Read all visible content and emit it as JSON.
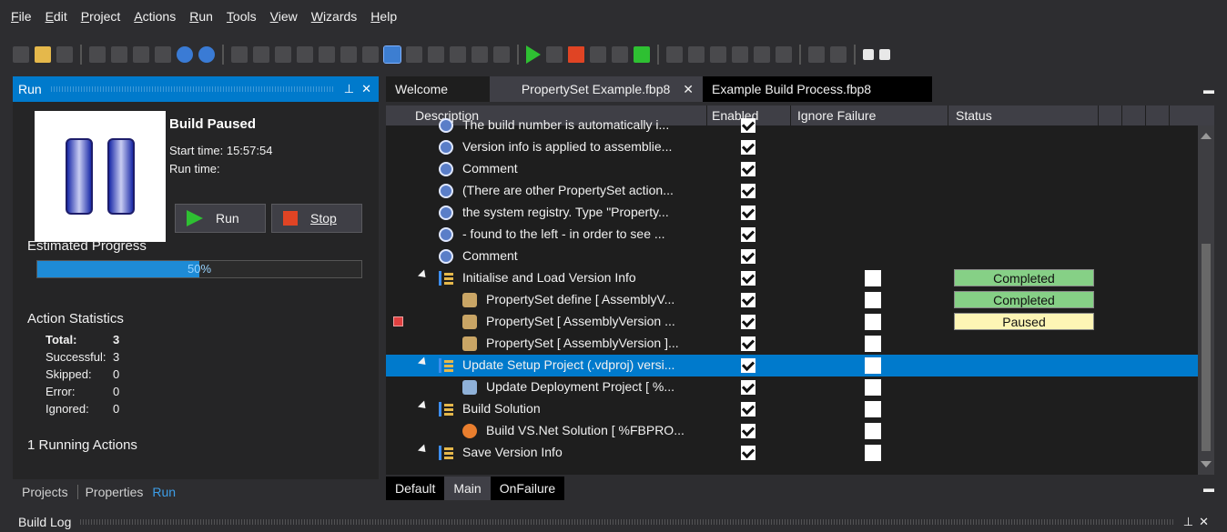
{
  "menu": [
    {
      "label": "File",
      "u": "F",
      "rest": "ile"
    },
    {
      "label": "Edit",
      "u": "E",
      "rest": "dit"
    },
    {
      "label": "Project",
      "u": "P",
      "rest": "roject"
    },
    {
      "label": "Actions",
      "u": "A",
      "rest": "ctions"
    },
    {
      "label": "Run",
      "u": "R",
      "rest": "un"
    },
    {
      "label": "Tools",
      "u": "T",
      "rest": "ools"
    },
    {
      "label": "View",
      "u": "V",
      "rest": "iew"
    },
    {
      "label": "Wizards",
      "u": "W",
      "rest": "izards"
    },
    {
      "label": "Help",
      "u": "H",
      "rest": "elp"
    }
  ],
  "run_panel": {
    "title": "Run",
    "pin": "4",
    "close": "✕",
    "status": "Build Paused",
    "start_time": "Start time:  15:57:54",
    "run_time": "Run time:",
    "run_button": "Run",
    "stop_button": "Stop",
    "estimated_label": "Estimated Progress",
    "progress_value": 50,
    "progress_text": "50%",
    "stats_title": "Action Statistics",
    "stats": [
      {
        "label": "Total:",
        "value": "3"
      },
      {
        "label": "Successful:",
        "value": "3"
      },
      {
        "label": "Skipped:",
        "value": "0"
      },
      {
        "label": "Error:",
        "value": "0"
      },
      {
        "label": "Ignored:",
        "value": "0"
      }
    ],
    "running": "1 Running Actions"
  },
  "bottom_tabs": [
    "Projects",
    "Properties",
    "Run"
  ],
  "doc_tabs": [
    {
      "label": "Welcome"
    },
    {
      "label": "PropertySet Example.fbp8",
      "close": "✕"
    },
    {
      "label": "Example Build Process.fbp8"
    }
  ],
  "grid": {
    "columns": [
      "Description",
      "Enabled",
      "Ignore Failure",
      "Status"
    ],
    "rows": [
      {
        "label": "The build number is automatically i...",
        "icon": "info",
        "indent": 1,
        "partial": true
      },
      {
        "label": "Version info is applied to assemblie...",
        "icon": "info",
        "indent": 1
      },
      {
        "label": "Comment",
        "icon": "info",
        "indent": 1
      },
      {
        "label": "(There are other PropertySet action...",
        "icon": "info",
        "indent": 1
      },
      {
        "label": "the system registry. Type \"Property...",
        "icon": "info",
        "indent": 1
      },
      {
        "label": "- found to the left - in order to see ...",
        "icon": "info",
        "indent": 1
      },
      {
        "label": "Comment",
        "icon": "info",
        "indent": 1
      },
      {
        "label": "Initialise and Load Version Info",
        "icon": "group",
        "indent": 0,
        "expander": true,
        "ignore": true,
        "status": "Completed"
      },
      {
        "label": "PropertySet define [ AssemblyV...",
        "icon": "prop",
        "indent": 2,
        "ignore": true,
        "status": "Completed"
      },
      {
        "label": "PropertySet  [ AssemblyVersion ...",
        "icon": "prop",
        "indent": 2,
        "ignore": true,
        "status": "Paused",
        "flag": true
      },
      {
        "label": "PropertySet [ AssemblyVersion ]...",
        "icon": "prop",
        "indent": 2,
        "ignore": true
      },
      {
        "label": "Update Setup Project (.vdproj) versi...",
        "icon": "group",
        "indent": 0,
        "expander": true,
        "ignore": true,
        "selected": true
      },
      {
        "label": "Update Deployment Project [ %...",
        "icon": "setup",
        "indent": 2,
        "ignore": true
      },
      {
        "label": "Build Solution",
        "icon": "group",
        "indent": 0,
        "expander": true,
        "ignore": true
      },
      {
        "label": "Build VS.Net Solution [ %FBPRO...",
        "icon": "vs",
        "indent": 2,
        "ignore": true
      },
      {
        "label": "Save Version Info",
        "icon": "group",
        "indent": 0,
        "expander": true,
        "ignore": true
      }
    ]
  },
  "sheet_tabs": [
    "Default",
    "Main",
    "OnFailure"
  ],
  "build_log": {
    "title": "Build Log",
    "pin": "4",
    "close": "✕"
  },
  "colors": {
    "accent": "#007acc",
    "completed": "#86d086",
    "paused": "#fdf5b5"
  }
}
